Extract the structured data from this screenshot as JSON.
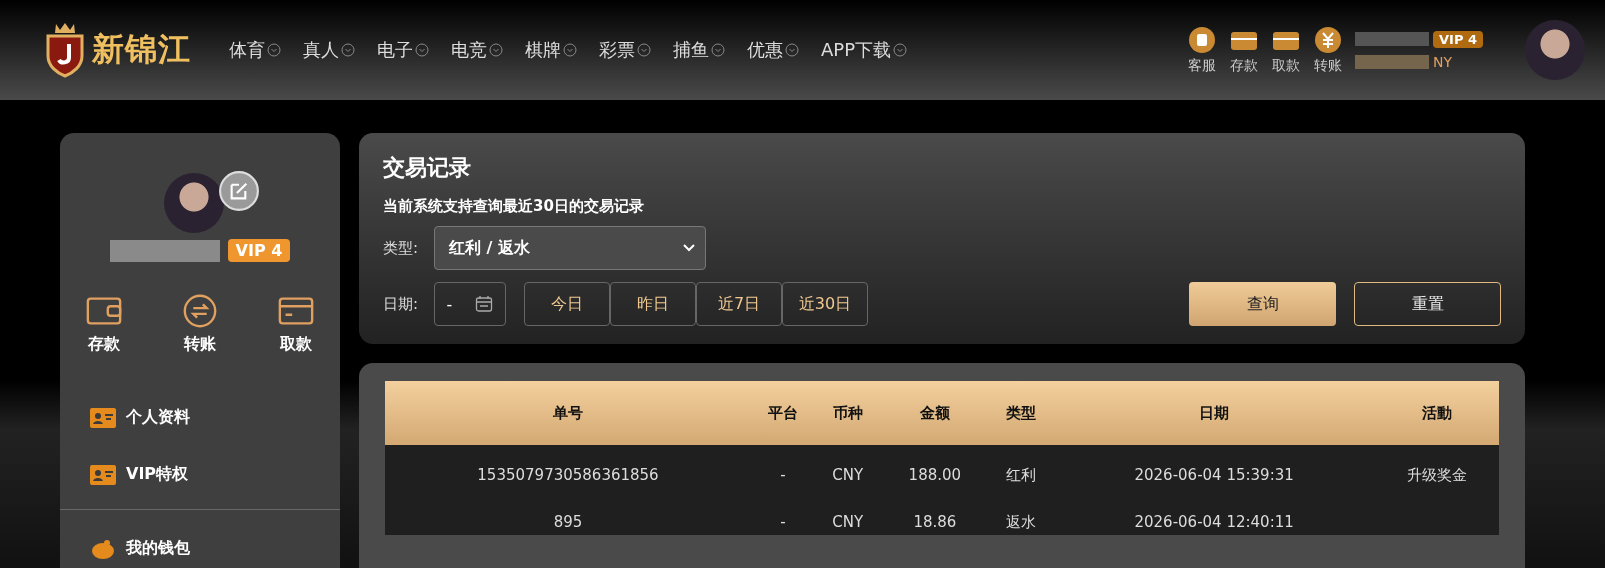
{
  "header": {
    "logo_text": "新锦江",
    "nav": [
      {
        "label": "体育"
      },
      {
        "label": "真人"
      },
      {
        "label": "电子"
      },
      {
        "label": "电竞"
      },
      {
        "label": "棋牌"
      },
      {
        "label": "彩票"
      },
      {
        "label": "捕鱼"
      },
      {
        "label": "优惠"
      },
      {
        "label": "APP下载"
      }
    ],
    "actions": [
      {
        "kind": "service",
        "label": "客服"
      },
      {
        "kind": "deposit",
        "label": "存款"
      },
      {
        "kind": "withdraw",
        "label": "取款"
      },
      {
        "kind": "transfer",
        "label": "转账"
      }
    ],
    "account": {
      "vip": "VIP 4",
      "currency": "NY"
    }
  },
  "sidebar": {
    "vip": "VIP 4",
    "actions": [
      {
        "kind": "deposit",
        "label": "存款"
      },
      {
        "kind": "transfer",
        "label": "转账"
      },
      {
        "kind": "withdraw",
        "label": "取款"
      }
    ],
    "menu": [
      {
        "kind": "card",
        "label": "个人资料"
      },
      {
        "kind": "card",
        "label": "VIP特权"
      }
    ],
    "menu_2": [
      {
        "kind": "piggy",
        "label": "我的钱包"
      }
    ]
  },
  "filter": {
    "title": "交易记录",
    "note": "当前系统支持查询最近30日的交易记录",
    "type_label": "类型:",
    "type_value": "红利 / 返水",
    "date_label": "日期:",
    "date_value": "-",
    "ranges": [
      {
        "label": "今日"
      },
      {
        "label": "昨日"
      },
      {
        "label": "近7日"
      },
      {
        "label": "近30日"
      }
    ],
    "buttons": [
      {
        "kind": "primary",
        "label": "查询"
      },
      {
        "kind": "outline",
        "label": "重置"
      }
    ]
  },
  "table": {
    "columns": [
      "单号",
      "平台",
      "币种",
      "金额",
      "类型",
      "日期",
      "活動"
    ],
    "rows": [
      [
        "1535079730586361856",
        "-",
        "CNY",
        "188.00",
        "红利",
        "2026-06-04 15:39:31",
        "升级奖金"
      ],
      [
        "895",
        "-",
        "CNY",
        "18.86",
        "返水",
        "2026-06-04 12:40:11",
        ""
      ]
    ]
  }
}
